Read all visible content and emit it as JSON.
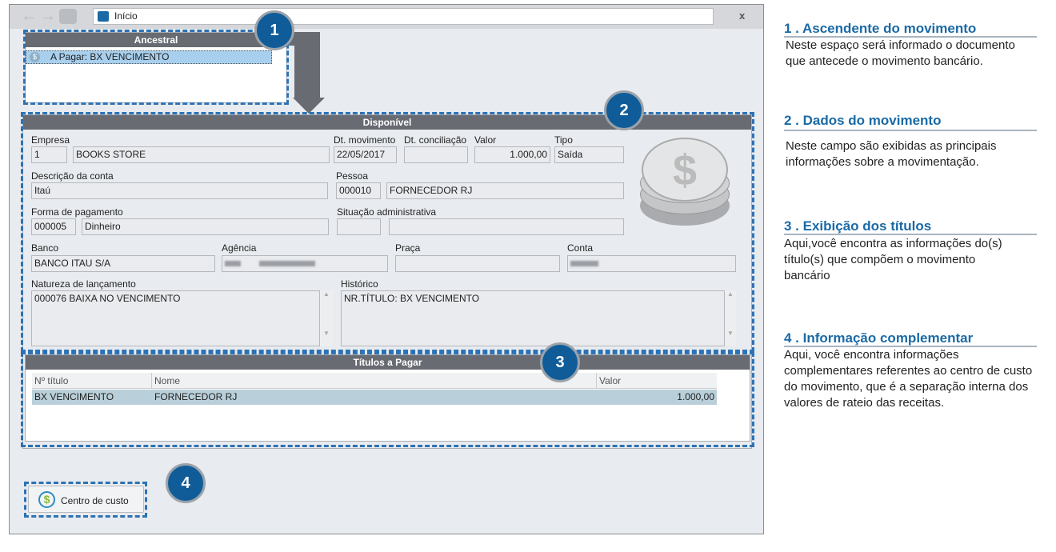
{
  "window": {
    "address": "Início",
    "close": "x"
  },
  "ancestral": {
    "title": "Ancestral",
    "items": [
      {
        "label": "A Pagar: BX VENCIMENTO"
      }
    ]
  },
  "disponivel": {
    "title": "Disponível",
    "empresa": {
      "label": "Empresa",
      "code": "1",
      "name": "BOOKS STORE"
    },
    "dt_movimento": {
      "label": "Dt. movimento",
      "value": "22/05/2017"
    },
    "dt_conciliacao": {
      "label": "Dt. conciliação",
      "value": ""
    },
    "valor": {
      "label": "Valor",
      "value": "1.000,00"
    },
    "tipo": {
      "label": "Tipo",
      "value": "Saída"
    },
    "descricao_conta": {
      "label": "Descrição da conta",
      "value": "Itaú"
    },
    "pessoa": {
      "label": "Pessoa",
      "code": "000010",
      "name": "FORNECEDOR RJ"
    },
    "forma_pagamento": {
      "label": "Forma de pagamento",
      "code": "000005",
      "name": "Dinheiro"
    },
    "situacao": {
      "label": "Situação administrativa",
      "code": "",
      "name": ""
    },
    "banco": {
      "label": "Banco",
      "value": "BANCO ITAU S/A"
    },
    "agencia": {
      "label": "Agência"
    },
    "praca": {
      "label": "Praça",
      "value": ""
    },
    "conta": {
      "label": "Conta"
    },
    "natureza": {
      "label": "Natureza de lançamento",
      "value": "000076  BAIXA NO VENCIMENTO"
    },
    "historico": {
      "label": "Histórico",
      "value": "NR.TÍTULO: BX VENCIMENTO"
    }
  },
  "titulos": {
    "title": "Títulos a Pagar",
    "columns": [
      "Nº título",
      "Nome",
      "Valor"
    ],
    "rows": [
      [
        "BX VENCIMENTO",
        "FORNECEDOR RJ",
        "1.000,00"
      ]
    ]
  },
  "centro_custo": {
    "label": "Centro de custo"
  },
  "badges": [
    "1",
    "2",
    "3",
    "4"
  ],
  "notes": [
    {
      "title": "1 . Ascendente do movimento",
      "text": "Neste espaço será informado o documento que antecede o movimento bancário."
    },
    {
      "title": "2 . Dados do movimento",
      "text": "Neste campo são exibidas as principais informações sobre a movimentação."
    },
    {
      "title": "3 . Exibição dos títulos",
      "text": "Aqui,você encontra as informações do(s) título(s) que compõem o movimento bancário"
    },
    {
      "title": "4 . Informação complementar",
      "text": "Aqui, você encontra informações complementares referentes ao centro de custo do movimento, que é a separação interna dos valores de rateio das receitas."
    }
  ],
  "colors": {
    "accent": "#0f5c99",
    "header": "#686b72",
    "selection": "#a8d0ee",
    "row": "#b9d0da"
  }
}
